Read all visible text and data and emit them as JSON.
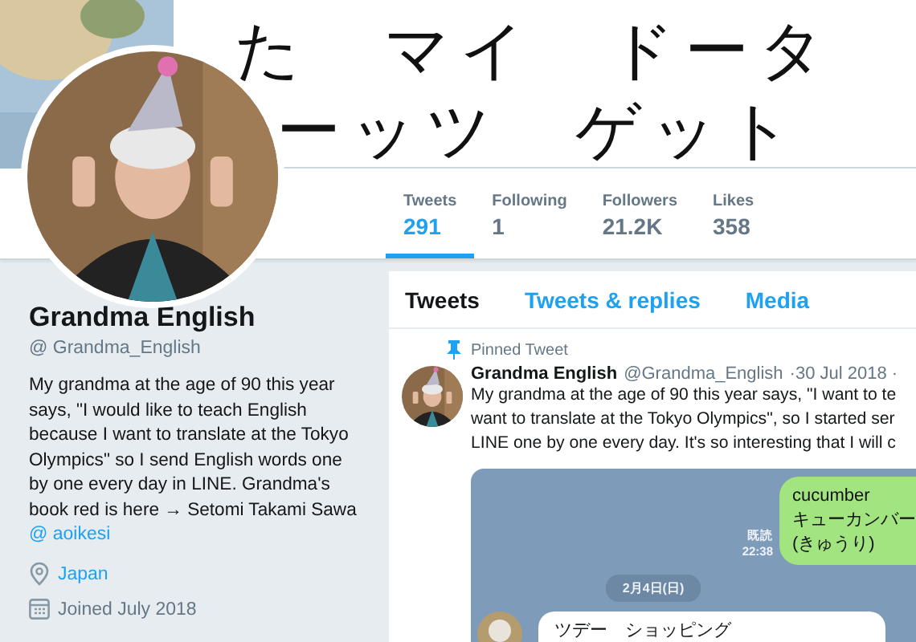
{
  "banner": {
    "lines": [
      "た　マイ　ドータ",
      "ーッツ　ゲット"
    ]
  },
  "stats": [
    {
      "label": "Tweets",
      "value": "291",
      "selected": true
    },
    {
      "label": "Following",
      "value": "1",
      "selected": false
    },
    {
      "label": "Followers",
      "value": "21.2K",
      "selected": false
    },
    {
      "label": "Likes",
      "value": "358",
      "selected": false
    }
  ],
  "profile": {
    "name": "Grandma English",
    "handle": "@ Grandma_English",
    "bio": "My grandma at the age of 90 this year says, \"I would like to teach English because I want to translate at the Tokyo Olympics\" so I send English words one by one every day in LINE. Grandma's book red is here → Setomi Takami Sawa",
    "bio_link": "@ aoikesi",
    "location": "Japan",
    "joined": "Joined July 2018"
  },
  "tabs": [
    {
      "label": "Tweets",
      "selected": true
    },
    {
      "label": "Tweets & replies",
      "selected": false
    },
    {
      "label": "Media",
      "selected": false
    }
  ],
  "pinned_tweet": {
    "label": "Pinned Tweet",
    "author": "Grandma English",
    "handle": "@Grandma_English",
    "date": "·30 Jul 2018 ·",
    "lines": [
      "My grandma at the age of 90 this year says, \"I want to te",
      "want to translate at the Tokyo Olympics\", so I started ser",
      "LINE one by one every day. It's so interesting that I will c"
    ],
    "chat": {
      "sent": {
        "lines": [
          "cucumber",
          "キューカンバー",
          "(きゅうり)"
        ],
        "read": "既読",
        "time": "22:38"
      },
      "date": "2月4日(日)",
      "received": {
        "lines": [
          "ツデー　ショッピング"
        ]
      }
    }
  }
}
